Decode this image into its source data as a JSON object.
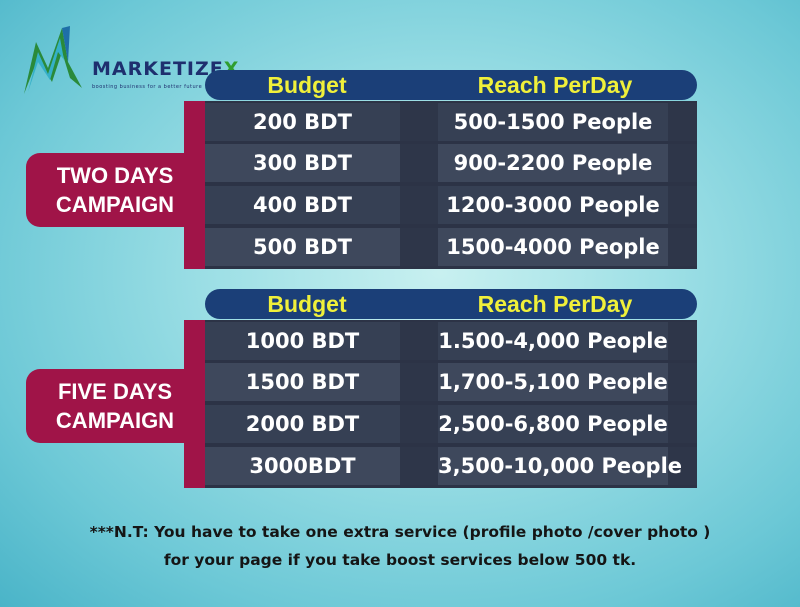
{
  "brand": {
    "name_main": "MARKETIZE",
    "name_x": "X",
    "tagline": "boosting business for a better future"
  },
  "headers": {
    "budget": "Budget",
    "reach": "Reach PerDay"
  },
  "campaigns": [
    {
      "label_line1": "TWO DAYS",
      "label_line2": "CAMPAIGN",
      "rows": [
        {
          "budget": "200 BDT",
          "reach": "500-1500 People"
        },
        {
          "budget": "300 BDT",
          "reach": "900-2200 People"
        },
        {
          "budget": "400 BDT",
          "reach": "1200-3000 People"
        },
        {
          "budget": "500 BDT",
          "reach": "1500-4000 People"
        }
      ]
    },
    {
      "label_line1": "FIVE DAYS",
      "label_line2": "CAMPAIGN",
      "rows": [
        {
          "budget": "1000 BDT",
          "reach": "1.500-4,000 People"
        },
        {
          "budget": "1500 BDT",
          "reach": "1,700-5,100 People"
        },
        {
          "budget": "2000 BDT",
          "reach": "2,500-6,800 People"
        },
        {
          "budget": "3000BDT",
          "reach": "3,500-10,000 People"
        }
      ]
    }
  ],
  "note": {
    "line1": "***N.T: You have to take one extra service (profile photo /cover photo )",
    "line2": "for your page if you take boost services below 500 tk."
  },
  "colors": {
    "accent_crimson": "#a01448",
    "header_navy": "#1b3f78",
    "header_text_yellow": "#f0f03a",
    "table_dark": "#2c3346"
  }
}
